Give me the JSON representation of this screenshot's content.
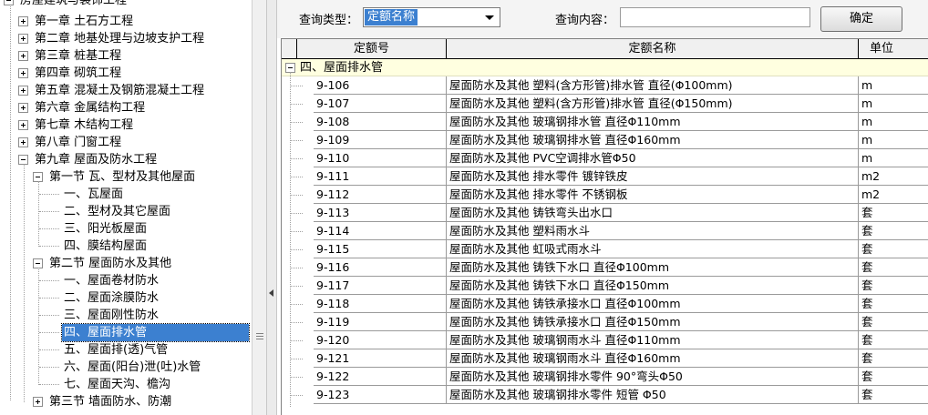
{
  "tree": {
    "root_label": "房屋建筑与装饰工程",
    "chapters": [
      {
        "label": "第一章  土石方工程"
      },
      {
        "label": "第二章  地基处理与边坡支护工程"
      },
      {
        "label": "第三章  桩基工程"
      },
      {
        "label": "第四章  砌筑工程"
      },
      {
        "label": "第五章  混凝土及钢筋混凝土工程"
      },
      {
        "label": "第六章  金属结构工程"
      },
      {
        "label": "第七章  木结构工程"
      },
      {
        "label": "第八章  门窗工程"
      },
      {
        "label": "第九章  屋面及防水工程"
      }
    ],
    "section1": {
      "label": "第一节  瓦、型材及其他屋面",
      "items": [
        "一、瓦屋面",
        "二、型材及其它屋面",
        "三、阳光板屋面",
        "四、膜结构屋面"
      ]
    },
    "section2": {
      "label": "第二节  屋面防水及其他",
      "items": [
        "一、屋面卷材防水",
        "二、屋面涂膜防水",
        "三、屋面刚性防水",
        "四、屋面排水管",
        "五、屋面排(透)气管",
        "六、屋面(阳台)泄(吐)水管",
        "七、屋面天沟、檐沟"
      ]
    },
    "section3": {
      "label": "第三节  墙面防水、防潮"
    },
    "selected_item": "四、屋面排水管"
  },
  "search": {
    "type_label": "查询类型：",
    "type_value": "定额名称",
    "content_label": "查询内容：",
    "content_value": "",
    "ok_label": "确定"
  },
  "grid": {
    "headers": {
      "code": "定额号",
      "name": "定额名称",
      "unit": "单位"
    },
    "group_label": "四、屋面排水管",
    "rows": [
      {
        "code": "9-106",
        "name": "屋面防水及其他 塑料(含方形管)排水管 直径(Φ100mm)",
        "unit": "m"
      },
      {
        "code": "9-107",
        "name": "屋面防水及其他 塑料(含方形管)排水管 直径(Φ150mm)",
        "unit": "m"
      },
      {
        "code": "9-108",
        "name": "屋面防水及其他 玻璃钢排水管 直径Φ110mm",
        "unit": "m"
      },
      {
        "code": "9-109",
        "name": "屋面防水及其他 玻璃钢排水管 直径Φ160mm",
        "unit": "m"
      },
      {
        "code": "9-110",
        "name": "屋面防水及其他 PVC空调排水管Φ50",
        "unit": "m"
      },
      {
        "code": "9-111",
        "name": "屋面防水及其他 排水零件 镀锌铁皮",
        "unit": "m2"
      },
      {
        "code": "9-112",
        "name": "屋面防水及其他 排水零件 不锈钢板",
        "unit": "m2"
      },
      {
        "code": "9-113",
        "name": "屋面防水及其他 铸铁弯头出水口",
        "unit": "套"
      },
      {
        "code": "9-114",
        "name": "屋面防水及其他 塑料雨水斗",
        "unit": "套"
      },
      {
        "code": "9-115",
        "name": "屋面防水及其他 虹吸式雨水斗",
        "unit": "套"
      },
      {
        "code": "9-116",
        "name": "屋面防水及其他 铸铁下水口 直径Φ100mm",
        "unit": "套"
      },
      {
        "code": "9-117",
        "name": "屋面防水及其他 铸铁下水口 直径Φ150mm",
        "unit": "套"
      },
      {
        "code": "9-118",
        "name": "屋面防水及其他 铸铁承接水口 直径Φ100mm",
        "unit": "套"
      },
      {
        "code": "9-119",
        "name": "屋面防水及其他 铸铁承接水口 直径Φ150mm",
        "unit": "套"
      },
      {
        "code": "9-120",
        "name": "屋面防水及其他 玻璃钢雨水斗 直径Φ110mm",
        "unit": "套"
      },
      {
        "code": "9-121",
        "name": "屋面防水及其他 玻璃钢雨水斗 直径Φ160mm",
        "unit": "套"
      },
      {
        "code": "9-122",
        "name": "屋面防水及其他 玻璃钢排水零件 90°弯头Φ50",
        "unit": "套"
      },
      {
        "code": "9-123",
        "name": "屋面防水及其他 玻璃钢排水零件 短管 Φ50",
        "unit": "套"
      }
    ]
  }
}
